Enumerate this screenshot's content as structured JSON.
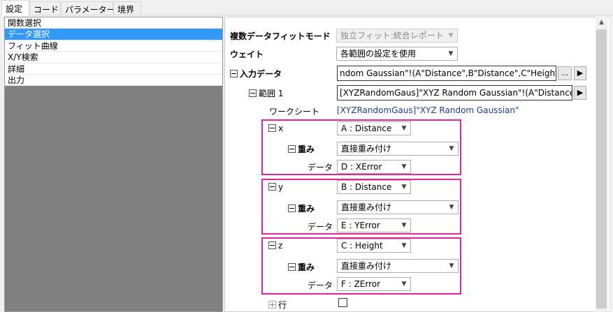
{
  "tabs": [
    {
      "label": "設定"
    },
    {
      "label": "コード"
    },
    {
      "label": "パラメーター"
    },
    {
      "label": "境界"
    }
  ],
  "sidebar": {
    "items": [
      {
        "label": "関数選択"
      },
      {
        "label": "データ選択"
      },
      {
        "label": "フィット曲線"
      },
      {
        "label": "X/Y検索"
      },
      {
        "label": "詳細"
      },
      {
        "label": "出力"
      }
    ]
  },
  "settings": {
    "multi_fit_label": "複数データフィットモード",
    "multi_fit_value": "独立フィット:統合レポート",
    "weight_label": "ウェイト",
    "weight_value": "各範囲の設定を使用",
    "input_label": "入力データ",
    "input_value": "ndom Gaussian\"!(A\"Distance\",B\"Distance\",C\"Height\")",
    "range_label": "範囲 1",
    "range_value": "[XYZRandomGaus]\"XYZ Random Gaussian\"!(A\"Distance\",B",
    "worksheet_label": "ワークシート",
    "worksheet_value": "[XYZRandomGaus]\"XYZ Random Gaussian\"",
    "more_button": "...",
    "row_label": "行"
  },
  "axes": [
    {
      "name": "x",
      "column": "A : Distance",
      "weight_label": "重み",
      "weight_value": "直接重み付け",
      "data_label": "データ",
      "data_value": "D : XError"
    },
    {
      "name": "y",
      "column": "B : Distance",
      "weight_label": "重み",
      "weight_value": "直接重み付け",
      "data_label": "データ",
      "data_value": "E : YError"
    },
    {
      "name": "z",
      "column": "C : Height",
      "weight_label": "重み",
      "weight_value": "直接重み付け",
      "data_label": "データ",
      "data_value": "F : ZError"
    }
  ],
  "colors": {
    "selection": "#3399ff",
    "highlight": "#e6229c",
    "link": "#1e3ca8"
  }
}
